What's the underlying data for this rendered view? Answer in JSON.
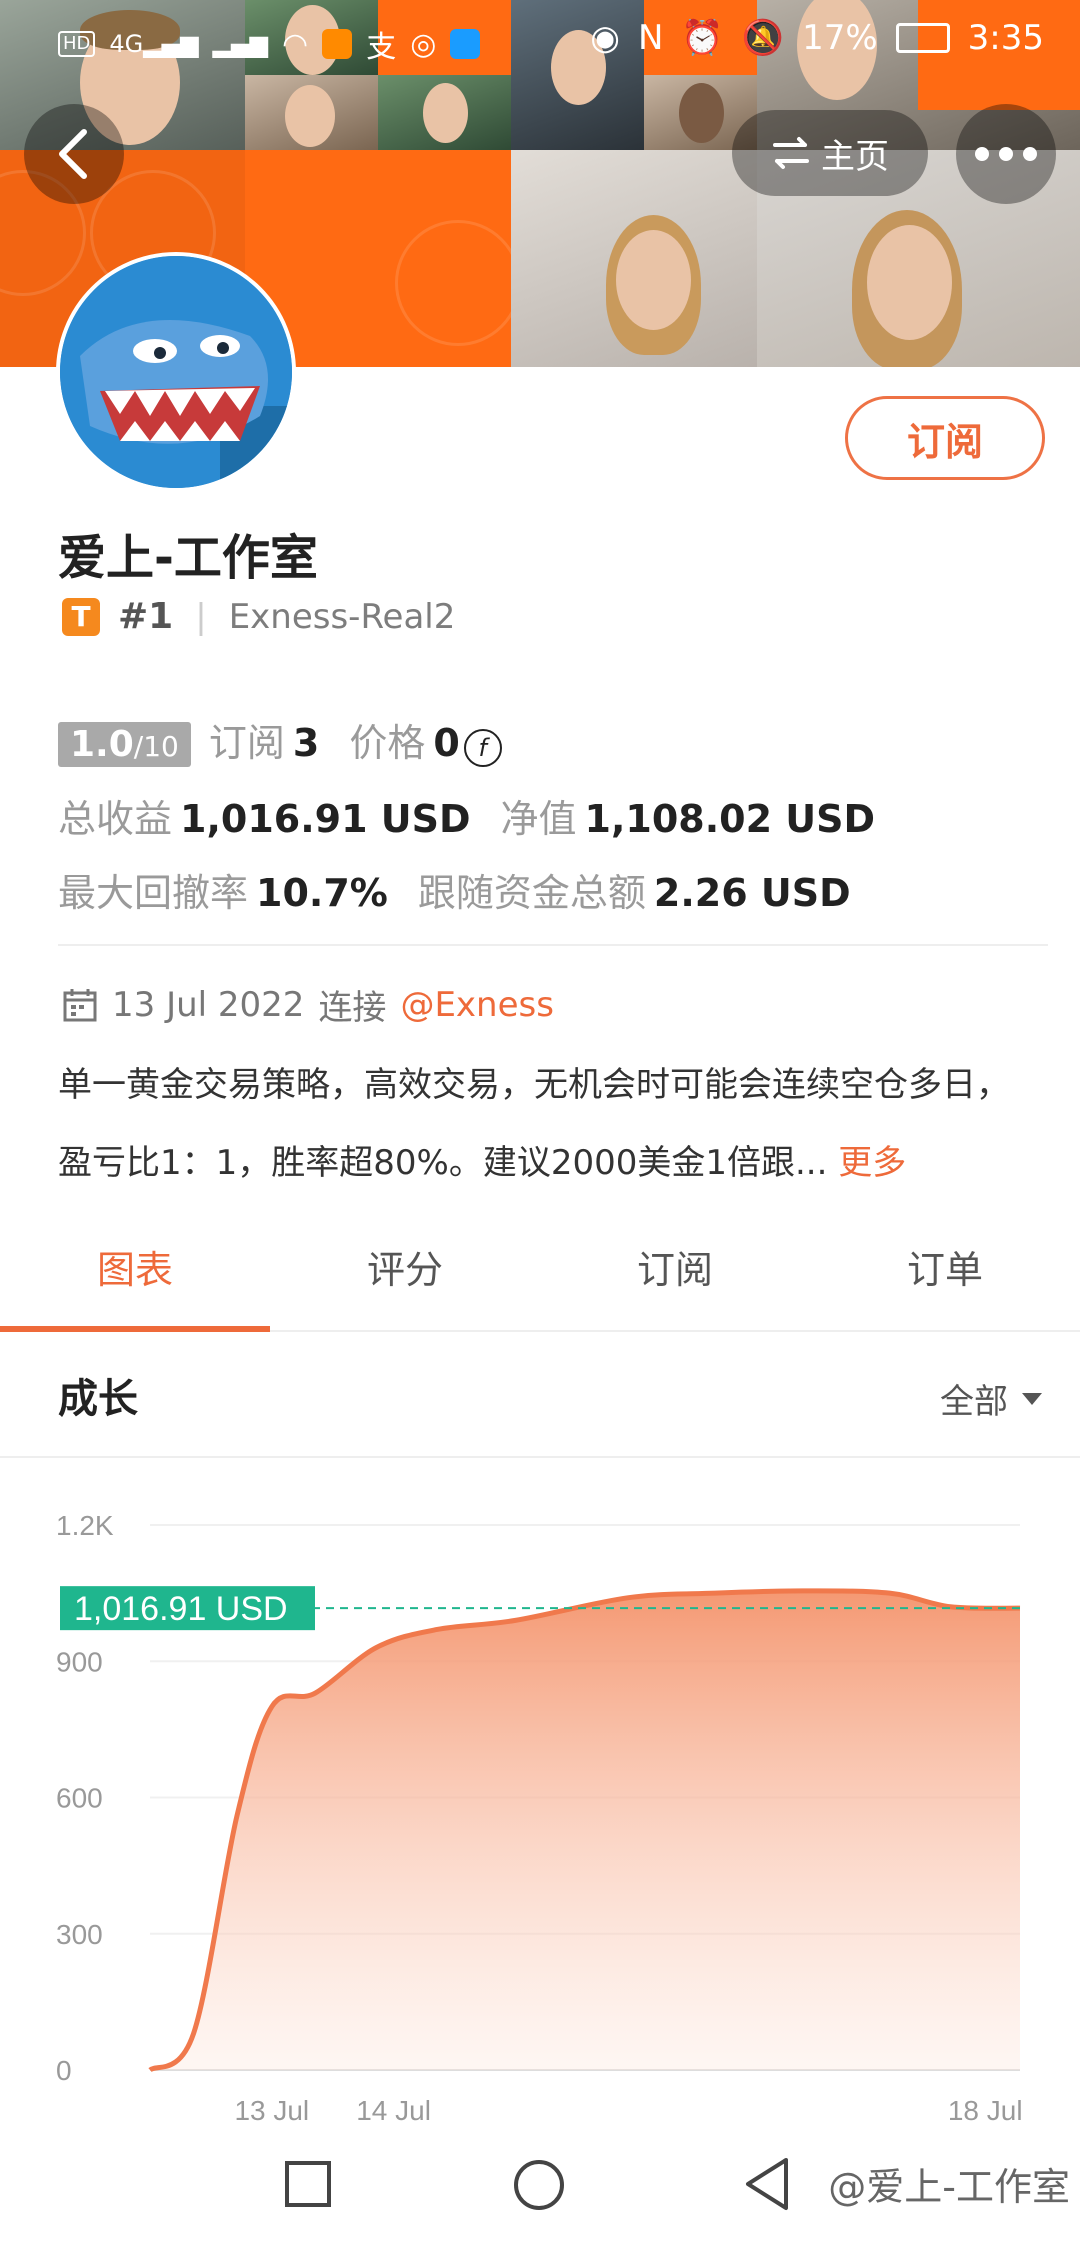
{
  "status_bar": {
    "left_icons": [
      "hd-icon",
      "signal-4g-icon",
      "signal-icon",
      "wifi-icon",
      "app-icon",
      "alipay-icon",
      "browser-icon",
      "search-app-icon"
    ],
    "battery": "17%",
    "time": "3:35"
  },
  "header": {
    "home_label": "主页"
  },
  "profile": {
    "subscribe_label": "订阅",
    "name": "爱上-工作室",
    "badge": "T",
    "rank": "#1",
    "server": "Exness-Real2",
    "score_main": "1.0",
    "score_max": "/10",
    "subscribers_label": "订阅",
    "subscribers": "3",
    "price_label": "价格",
    "price": "0",
    "total_profit_label": "总收益",
    "total_profit": "1,016.91 USD",
    "equity_label": "净值",
    "equity": "1,108.02 USD",
    "max_drawdown_label": "最大回撤率",
    "max_drawdown": "10.7%",
    "followers_funds_label": "跟随资金总额",
    "followers_funds": "2.26 USD",
    "connect_date": "13 Jul 2022",
    "connect_label": "连接",
    "broker": "@Exness",
    "description": "单一黄金交易策略，高效交易，无机会时可能会连续空仓多日，盈亏比1：1，胜率超80%。建议2000美金1倍跟...",
    "more_label": "更多"
  },
  "tabs": [
    {
      "label": "图表",
      "active": true
    },
    {
      "label": "评分",
      "active": false
    },
    {
      "label": "订阅",
      "active": false
    },
    {
      "label": "订单",
      "active": false
    }
  ],
  "growth": {
    "title": "成长",
    "filter_label": "全部"
  },
  "chart_data": {
    "type": "area",
    "title": "",
    "current_label": "1,016.91 USD",
    "current_value": 1016.91,
    "y_ticks": [
      "0",
      "300",
      "600",
      "900",
      "1.2K"
    ],
    "ylim": [
      0,
      1200
    ],
    "x_ticks": [
      "13 Jul",
      "14 Jul",
      "18 Jul"
    ],
    "points": [
      [
        0,
        0
      ],
      [
        0.05,
        80
      ],
      [
        0.1,
        560
      ],
      [
        0.14,
        800
      ],
      [
        0.19,
        830
      ],
      [
        0.26,
        930
      ],
      [
        0.33,
        970
      ],
      [
        0.42,
        990
      ],
      [
        0.55,
        1040
      ],
      [
        0.65,
        1050
      ],
      [
        0.75,
        1055
      ],
      [
        0.85,
        1050
      ],
      [
        0.92,
        1020
      ],
      [
        1.0,
        1016.91
      ]
    ],
    "colors": {
      "line": "#f0794c",
      "fill": "#f7a98a",
      "label_bg": "#1fb68e",
      "dash": "#1fb68e"
    }
  },
  "watermark": "@爱上-工作室"
}
